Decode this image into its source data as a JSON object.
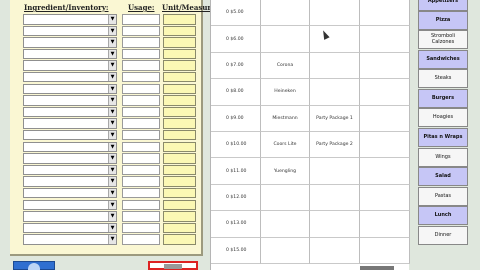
{
  "ingredient_panel": {
    "headers": {
      "ingredient": "Ingredient/Inventory:",
      "usage": "Usage:",
      "unit": "Unit/Measure"
    },
    "rows": 20
  },
  "grid": {
    "prices": [
      "0 $5.00",
      "0 $6.00",
      "0 $7.00",
      "0 $8.00",
      "0 $9.00",
      "0 $10.00",
      "0 $11.00",
      "0 $12.00",
      "0 $13.00",
      "0 $15.00"
    ],
    "col2": [
      "",
      "",
      "Corona",
      "Heineken",
      "Miestmann",
      "Coors Lite",
      "Yuengling",
      "",
      "",
      ""
    ],
    "col3": [
      "",
      "",
      "",
      "",
      "Party Package 1",
      "Party Package 2",
      "",
      "",
      "",
      ""
    ]
  },
  "menu": {
    "items": [
      {
        "label": "Appetizers",
        "style": "purple"
      },
      {
        "label": "Pizza",
        "style": "purple"
      },
      {
        "label": "Stromboli\nCalzones",
        "style": "light"
      },
      {
        "label": "Sandwiches",
        "style": "purple"
      },
      {
        "label": "Steaks",
        "style": "light"
      },
      {
        "label": "Burgers",
        "style": "purple"
      },
      {
        "label": "Hoagies",
        "style": "light"
      },
      {
        "label": "Pitas n Wraps",
        "style": "purple"
      },
      {
        "label": "Wings",
        "style": "light"
      },
      {
        "label": "Salad",
        "style": "purple"
      },
      {
        "label": "Pastas",
        "style": "light"
      },
      {
        "label": "Lunch",
        "style": "purple"
      },
      {
        "label": "Dinner",
        "style": "light"
      }
    ]
  }
}
